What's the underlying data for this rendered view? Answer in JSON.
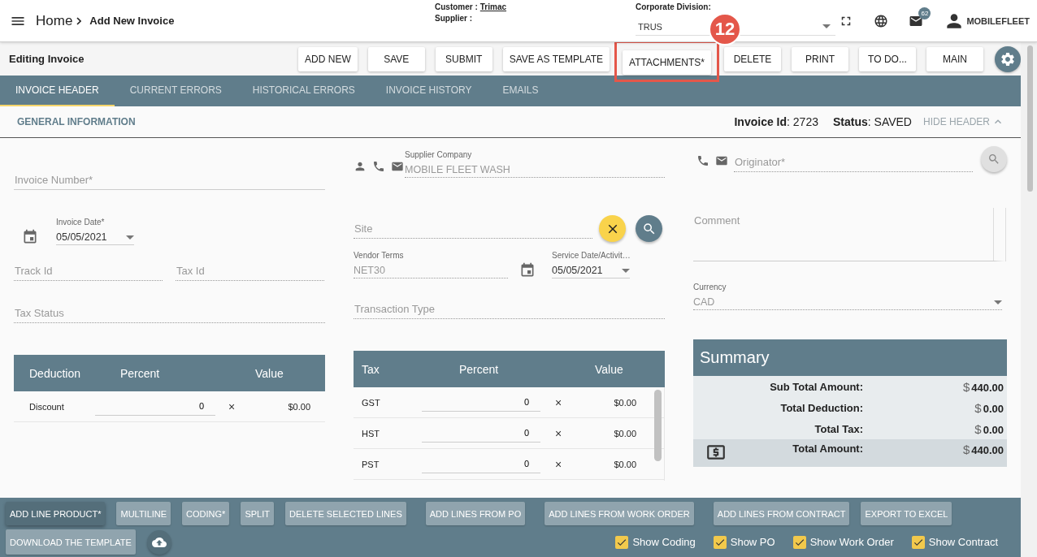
{
  "header": {
    "breadcrumb": "Home",
    "page_title": "Add New Invoice",
    "customer_label": "Customer :",
    "customer": "Trimac",
    "supplier_label": "Supplier :",
    "division_label": "Corporate Division:",
    "division": "TRUS",
    "mail_count": "62",
    "user": "MOBILEFLEET"
  },
  "toolbar": {
    "title": "Editing Invoice",
    "callout": "12",
    "buttons": [
      {
        "label": "ADD NEW",
        "highlighted": false
      },
      {
        "label": "SAVE",
        "highlighted": false
      },
      {
        "label": "SUBMIT",
        "highlighted": false
      },
      {
        "label": "SAVE AS TEMPLATE",
        "highlighted": false
      },
      {
        "label": "ATTACHMENTS*",
        "highlighted": true
      },
      {
        "label": "DELETE",
        "highlighted": false
      },
      {
        "label": "PRINT",
        "highlighted": false
      },
      {
        "label": "TO DO...",
        "highlighted": false
      },
      {
        "label": "MAIN",
        "highlighted": false
      }
    ]
  },
  "tabs": [
    {
      "label": "INVOICE HEADER",
      "selected": true
    },
    {
      "label": "CURRENT ERRORS",
      "selected": false
    },
    {
      "label": "HISTORICAL ERRORS",
      "selected": false
    },
    {
      "label": "INVOICE HISTORY",
      "selected": false
    },
    {
      "label": "EMAILS",
      "selected": false
    }
  ],
  "section": {
    "title": "GENERAL INFORMATION",
    "invoice_id": "**Invoice Id**: 2723",
    "status": "**Status**: SAVED",
    "toggle": "HIDE HEADER"
  },
  "form": {
    "invoice_number": {
      "placeholder": "Invoice Number*",
      "disabled": false
    },
    "invoice_date": {
      "label": "Invoice Date*",
      "value": "05/05/2021"
    },
    "track_id": {
      "placeholder": "Track Id",
      "disabled": true
    },
    "tax_id": {
      "placeholder": "Tax Id",
      "disabled": true
    },
    "tax_status": {
      "placeholder": "Tax Status",
      "disabled": true
    },
    "supplier_company": {
      "label": "Supplier Company",
      "value": "MOBILE FLEET WASH",
      "disabled": true
    },
    "site": {
      "placeholder": "Site",
      "disabled": true
    },
    "vendor_terms": {
      "label": "Vendor Terms",
      "value": "NET30",
      "disabled": true
    },
    "service_date": {
      "label": "Service Date/Activit…",
      "value": "05/05/2021"
    },
    "transaction_type": {
      "placeholder": "Transaction Type",
      "disabled": true
    },
    "originator": {
      "placeholder": "Originator*",
      "disabled": true
    },
    "comment": {
      "placeholder": "Comment"
    },
    "currency": {
      "label": "Currency",
      "value": "CAD",
      "disabled": true
    }
  },
  "deductions": {
    "columns": [
      "Deduction",
      "Percent",
      "Value"
    ],
    "rows": [
      {
        "name": "Discount",
        "percent": "0",
        "remove": "×",
        "value": "$0.00"
      }
    ]
  },
  "taxes": {
    "columns": [
      "Tax",
      "Percent",
      "Value"
    ],
    "rows": [
      {
        "name": "GST",
        "percent": "0",
        "remove": "×",
        "value": "$0.00"
      },
      {
        "name": "HST",
        "percent": "0",
        "remove": "×",
        "value": "$0.00"
      },
      {
        "name": "PST",
        "percent": "0",
        "remove": "×",
        "value": "$0.00"
      }
    ]
  },
  "summary": {
    "title": "Summary",
    "rows": [
      {
        "kind": "line",
        "label": "Sub Total Amount:",
        "currency": "$",
        "amount": "440.00"
      },
      {
        "kind": "line",
        "label": "Total Deduction:",
        "currency": "$",
        "amount": "0.00"
      },
      {
        "kind": "line",
        "label": "Total Tax:",
        "currency": "$",
        "amount": "0.00"
      },
      {
        "kind": "total",
        "label": "Total Amount:",
        "currency": "$",
        "amount": "440.00"
      }
    ]
  },
  "line_actions": {
    "buttons": [
      {
        "label": "ADD LINE PRODUCT*",
        "kind": "raised"
      },
      {
        "label": "MULTILINE",
        "kind": "flat"
      },
      {
        "label": "CODING*",
        "kind": "flat"
      },
      {
        "label": "SPLIT",
        "kind": "flat"
      },
      {
        "label": "DELETE SELECTED LINES",
        "kind": "flat"
      },
      {
        "label": "ADD LINES FROM PO",
        "kind": "flat"
      },
      {
        "label": "ADD LINES FROM WORK ORDER",
        "kind": "flat"
      },
      {
        "label": "ADD LINES FROM CONTRACT",
        "kind": "flat"
      },
      {
        "label": "EXPORT TO EXCEL",
        "kind": "flat"
      }
    ],
    "template_button": "DOWNLOAD THE TEMPLATE",
    "toggles": [
      {
        "label": "Show Coding",
        "checked": true
      },
      {
        "label": "Show PO",
        "checked": true
      },
      {
        "label": "Show Work Order",
        "checked": true
      },
      {
        "label": "Show Contract",
        "checked": true
      }
    ]
  }
}
